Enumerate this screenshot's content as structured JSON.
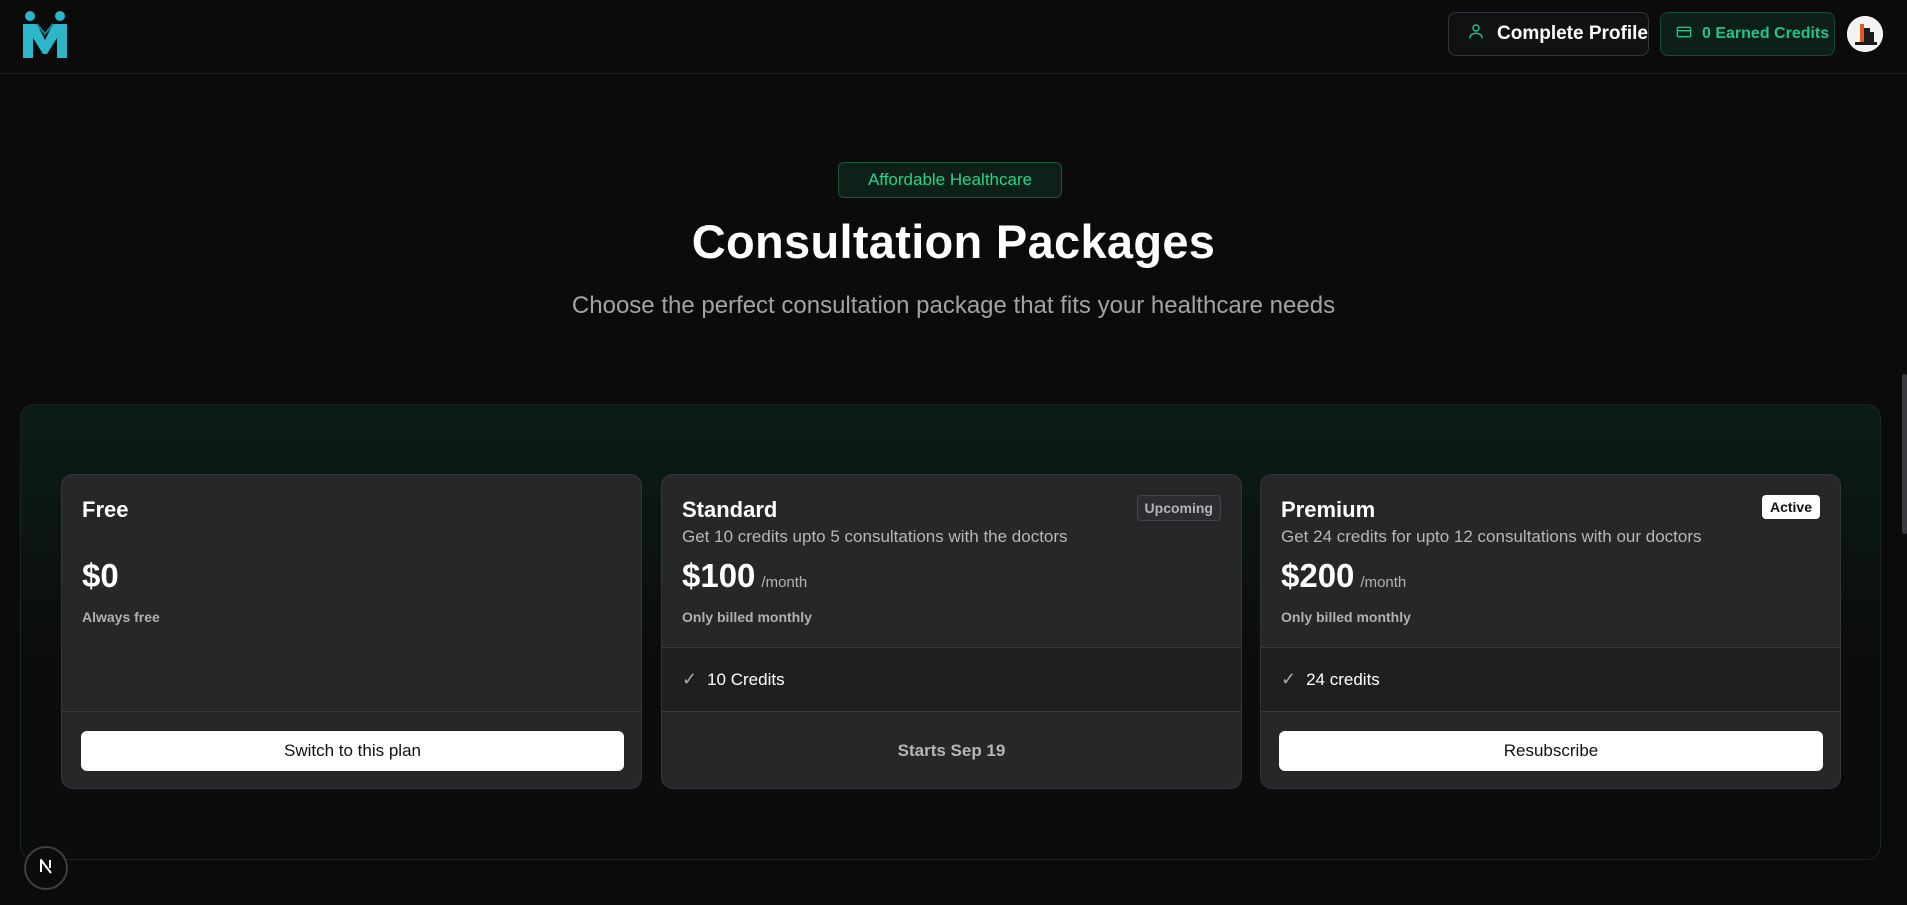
{
  "header": {
    "complete_profile_label": "Complete Profile",
    "credits_label": "0 Earned Credits"
  },
  "hero": {
    "tag": "Affordable Healthcare",
    "title": "Consultation Packages",
    "subtitle": "Choose the perfect consultation package that fits your healthcare needs"
  },
  "plans": [
    {
      "name": "Free",
      "description": "",
      "price": "$0",
      "period": "",
      "billing": "Always free",
      "action_label": "Switch to this plan"
    },
    {
      "name": "Standard",
      "badge": "Upcoming",
      "description": "Get 10 credits upto 5 consultations with the doctors",
      "price": "$100",
      "period": "/month",
      "billing": "Only billed monthly",
      "feature": "10 Credits",
      "status_text": "Starts Sep 19"
    },
    {
      "name": "Premium",
      "badge": "Active",
      "description": "Get 24 credits for upto 12 consultations with our doctors",
      "price": "$200",
      "period": "/month",
      "billing": "Only billed monthly",
      "feature": "24 credits",
      "action_label": "Resubscribe"
    }
  ],
  "icons": {
    "logo": "medical-m-logo-icon",
    "profile": "user-icon",
    "credits": "credit-card-icon",
    "check": "check-icon",
    "dev": "nextjs-icon"
  },
  "colors": {
    "accent": "#22c584",
    "background": "#0b0b0c",
    "card": "#27272a"
  }
}
